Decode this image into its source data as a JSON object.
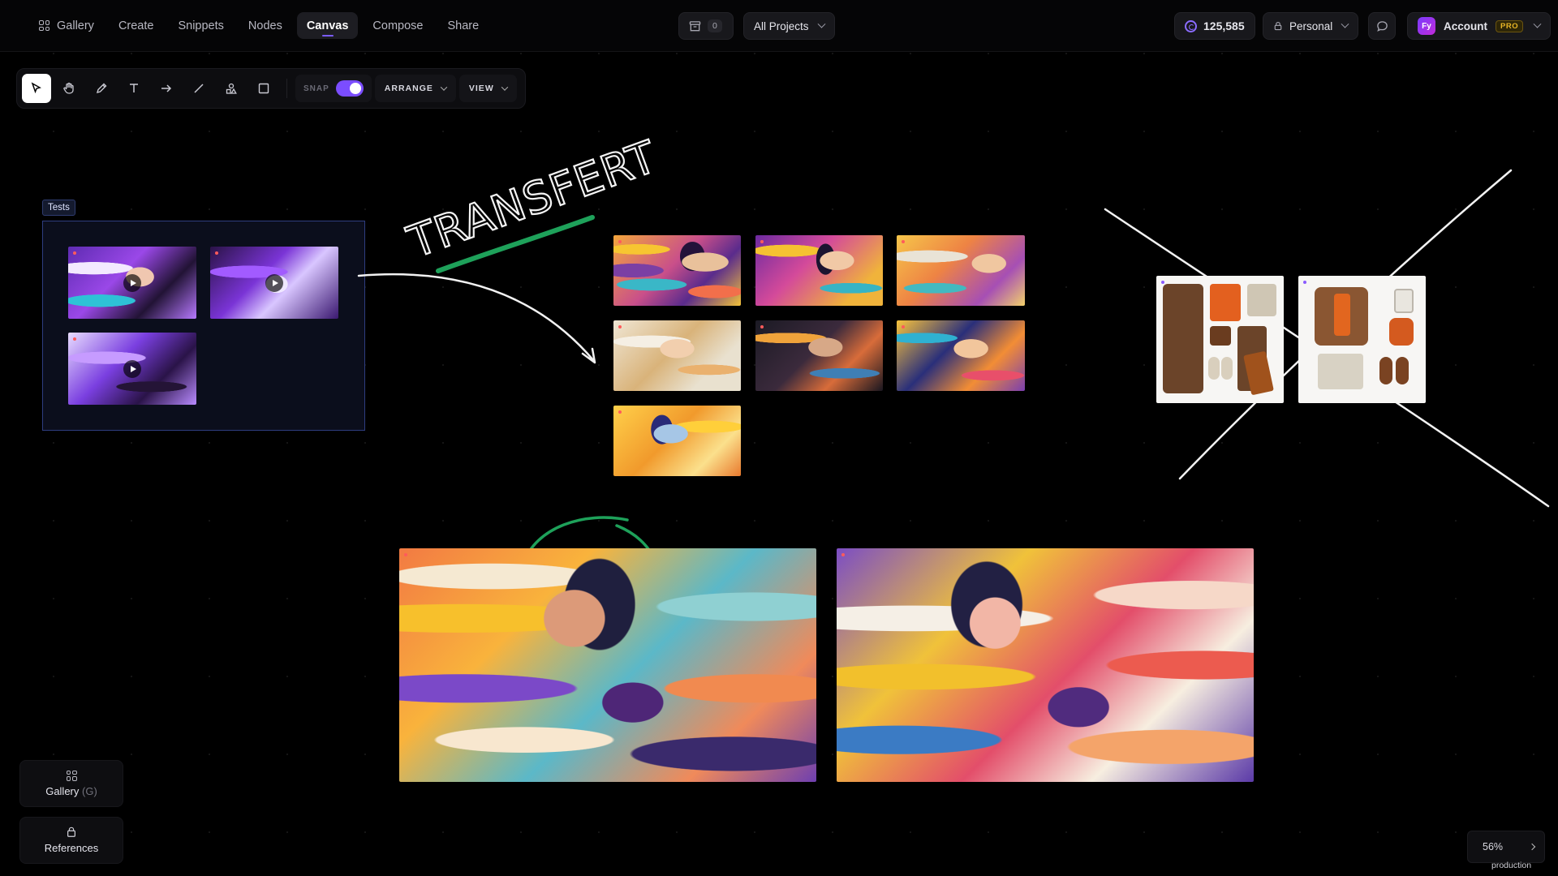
{
  "nav": {
    "items": [
      {
        "label": "Gallery"
      },
      {
        "label": "Create"
      },
      {
        "label": "Snippets"
      },
      {
        "label": "Nodes"
      },
      {
        "label": "Canvas",
        "active": true
      },
      {
        "label": "Compose"
      },
      {
        "label": "Share"
      }
    ]
  },
  "header": {
    "archive_count": "0",
    "projects_label": "All Projects",
    "credits": "125,585",
    "workspace_label": "Personal",
    "account_label": "Account",
    "account_badge": "PRO",
    "avatar_initials": "Fy"
  },
  "toolbar": {
    "tools": [
      "select-icon",
      "hand-icon",
      "pencil-icon",
      "text-icon",
      "arrow-icon",
      "line-icon",
      "shapes-icon",
      "rectangle-icon"
    ],
    "snap_label": "SNAP",
    "snap_on": true,
    "arrange_label": "ARRANGE",
    "view_label": "VIEW"
  },
  "canvas": {
    "group_label": "Tests",
    "annotation_text": "TRANSFERT",
    "colors": {
      "group_border": "#2e3d80",
      "accent": "#7b4dff",
      "underline_green": "#1ea15a",
      "circle_green": "#1ea15a"
    }
  },
  "panels": {
    "gallery_label": "Gallery",
    "gallery_hotkey": "(G)",
    "references_label": "References"
  },
  "zoom": {
    "level": "56%",
    "environment": "production"
  }
}
